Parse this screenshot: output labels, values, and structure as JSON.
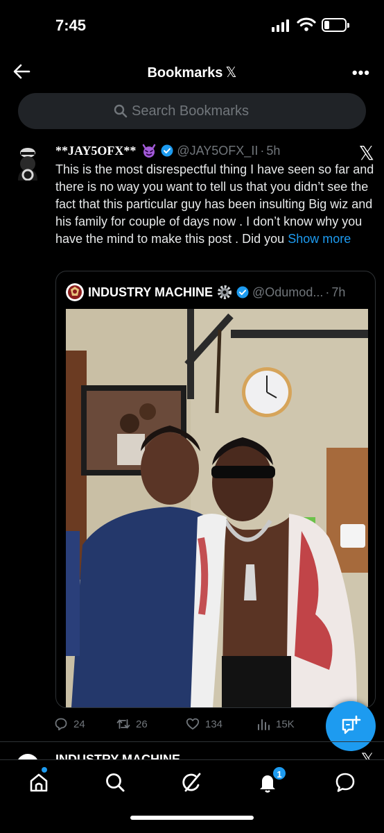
{
  "status_bar": {
    "time": "7:45"
  },
  "header": {
    "title": "Bookmarks",
    "title_glyph": "𝕏"
  },
  "search": {
    "placeholder": "Search Bookmarks"
  },
  "tweet": {
    "name": "**JAY5OFX**",
    "handle": "@JAY5OFX_II",
    "separator": "·",
    "age": "5h",
    "text": "This is the most disrespectful thing I have seen so far and there is no way you want to tell us that you didn’t see the fact that this particular guy has been insulting Big wiz and his family for couple of days now . I don’t know why you have the mind to make this post . Did you",
    "show_more": "Show more",
    "quote": {
      "name": "INDUSTRY MACHINE",
      "handle": "@Odumod...",
      "separator": "·",
      "age": "7h"
    },
    "stats": {
      "replies": "24",
      "reposts": "26",
      "likes": "134",
      "views": "15K"
    }
  },
  "next_tweet": {
    "name": "INDUSTRY MACHINE"
  },
  "nav": {
    "notifications_count": "1"
  },
  "colors": {
    "accent": "#1d9bf0",
    "background": "#000000",
    "muted": "#71767b",
    "search_bg": "#202327"
  }
}
